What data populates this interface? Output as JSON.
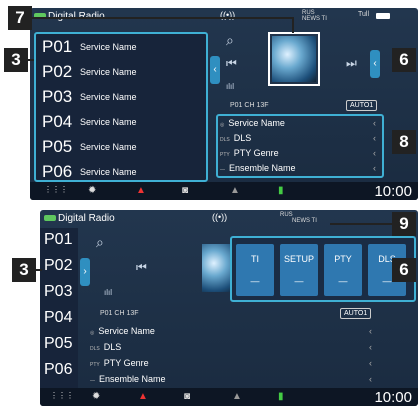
{
  "screen1": {
    "status": {
      "title": "Digital Radio",
      "antenna": "((•))",
      "mini1": "RUS",
      "mini2": "NEWS TI",
      "bars": "Tull"
    },
    "presets": [
      {
        "num": "P01",
        "name": "Service Name"
      },
      {
        "num": "P02",
        "name": "Service Name"
      },
      {
        "num": "P03",
        "name": "Service Name"
      },
      {
        "num": "P04",
        "name": "Service Name"
      },
      {
        "num": "P05",
        "name": "Service Name"
      },
      {
        "num": "P06",
        "name": "Service Name"
      }
    ],
    "channel": "P01   CH 13F",
    "auto": "AUTO1",
    "info": [
      {
        "sm": "◎",
        "label": "Service Name"
      },
      {
        "sm": "DLS",
        "label": "DLS"
      },
      {
        "sm": "PTY",
        "label": "PTY Genre"
      },
      {
        "sm": "—",
        "label": "Ensemble Name"
      }
    ],
    "clock": "10:00"
  },
  "screen2": {
    "status": {
      "title": "Digital Radio",
      "antenna": "((•))",
      "mini1": "RUS",
      "mini2": "NEWS TI"
    },
    "presets": [
      {
        "num": "P01"
      },
      {
        "num": "P02"
      },
      {
        "num": "P03"
      },
      {
        "num": "P04"
      },
      {
        "num": "P05"
      },
      {
        "num": "P06"
      }
    ],
    "functions": [
      {
        "label": "TI",
        "value": "—"
      },
      {
        "label": "SETUP",
        "value": "—"
      },
      {
        "label": "PTY",
        "value": "—"
      },
      {
        "label": "DLS",
        "value": "—"
      }
    ],
    "channel": "P01   CH 13F",
    "auto": "AUTO1",
    "info": [
      {
        "sm": "◎",
        "label": "Service Name"
      },
      {
        "sm": "DLS",
        "label": "DLS"
      },
      {
        "sm": "PTY",
        "label": "PTY Genre"
      },
      {
        "sm": "—",
        "label": "Ensemble Name"
      }
    ],
    "clock": "10:00"
  },
  "callouts": {
    "c3a": "3",
    "c6a": "6",
    "c7": "7",
    "c8": "8",
    "c3b": "3",
    "c6b": "6",
    "c9": "9"
  },
  "icons": {
    "search": "⌕",
    "prev": "⏮",
    "next": "⏭",
    "eq": "ılıl",
    "apps": "⋮⋮⋮",
    "settings": "✹",
    "nav": "▲",
    "media": "◙",
    "phone": "▮"
  },
  "colors": {
    "highlight": "#3fb0d4",
    "accent_tab": "#2f8fc0",
    "bg": "#1b2e45"
  }
}
